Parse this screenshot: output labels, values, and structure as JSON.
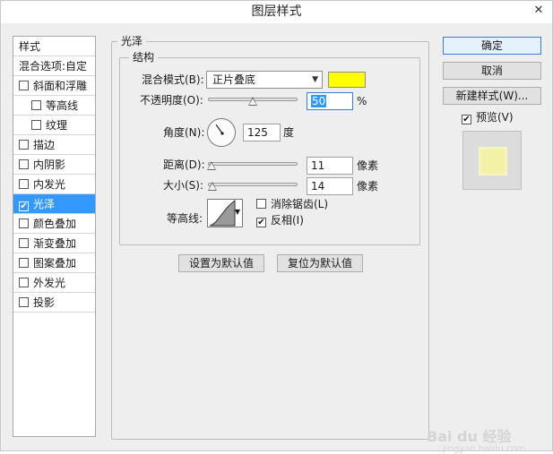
{
  "window": {
    "title": "图层样式",
    "close": "✕"
  },
  "style_list": {
    "header": "样式",
    "blend_options": "混合选项:自定",
    "items": [
      {
        "label": "斜面和浮雕",
        "checked": false,
        "sub": false
      },
      {
        "label": "等高线",
        "checked": false,
        "sub": true
      },
      {
        "label": "纹理",
        "checked": false,
        "sub": true
      },
      {
        "label": "描边",
        "checked": false,
        "sub": false
      },
      {
        "label": "内阴影",
        "checked": false,
        "sub": false
      },
      {
        "label": "内发光",
        "checked": false,
        "sub": false
      },
      {
        "label": "光泽",
        "checked": true,
        "sub": false,
        "selected": true
      },
      {
        "label": "颜色叠加",
        "checked": false,
        "sub": false
      },
      {
        "label": "渐变叠加",
        "checked": false,
        "sub": false
      },
      {
        "label": "图案叠加",
        "checked": false,
        "sub": false
      },
      {
        "label": "外发光",
        "checked": false,
        "sub": false
      },
      {
        "label": "投影",
        "checked": false,
        "sub": false
      }
    ]
  },
  "satin": {
    "group_title": "光泽",
    "structure_title": "结构",
    "blend_mode_label": "混合模式(B):",
    "blend_mode_value": "正片叠底",
    "color": "#ffff00",
    "opacity_label": "不透明度(O):",
    "opacity_value": "50",
    "opacity_unit": "%",
    "opacity_percent": 50,
    "angle_label": "角度(N):",
    "angle_value": "125",
    "angle_unit": "度",
    "angle_degrees": 125,
    "distance_label": "距离(D):",
    "distance_value": "11",
    "distance_unit": "像素",
    "distance_fraction": 0.04,
    "size_label": "大小(S):",
    "size_value": "14",
    "size_unit": "像素",
    "size_fraction": 0.05,
    "contour_label": "等高线:",
    "antialias_label": "消除锯齿(L)",
    "antialias_checked": false,
    "invert_label": "反相(I)",
    "invert_checked": true,
    "make_default": "设置为默认值",
    "reset_default": "复位为默认值"
  },
  "actions": {
    "ok": "确定",
    "cancel": "取消",
    "new_style": "新建样式(W)...",
    "preview_label": "预览(V)",
    "preview_checked": true
  },
  "watermark": {
    "brand": "Bai du",
    "suffix": "经验",
    "sub": "jingyan.baidu.com"
  },
  "icons": {
    "check": "✔",
    "dropdown": "▼",
    "close": "close-icon"
  }
}
